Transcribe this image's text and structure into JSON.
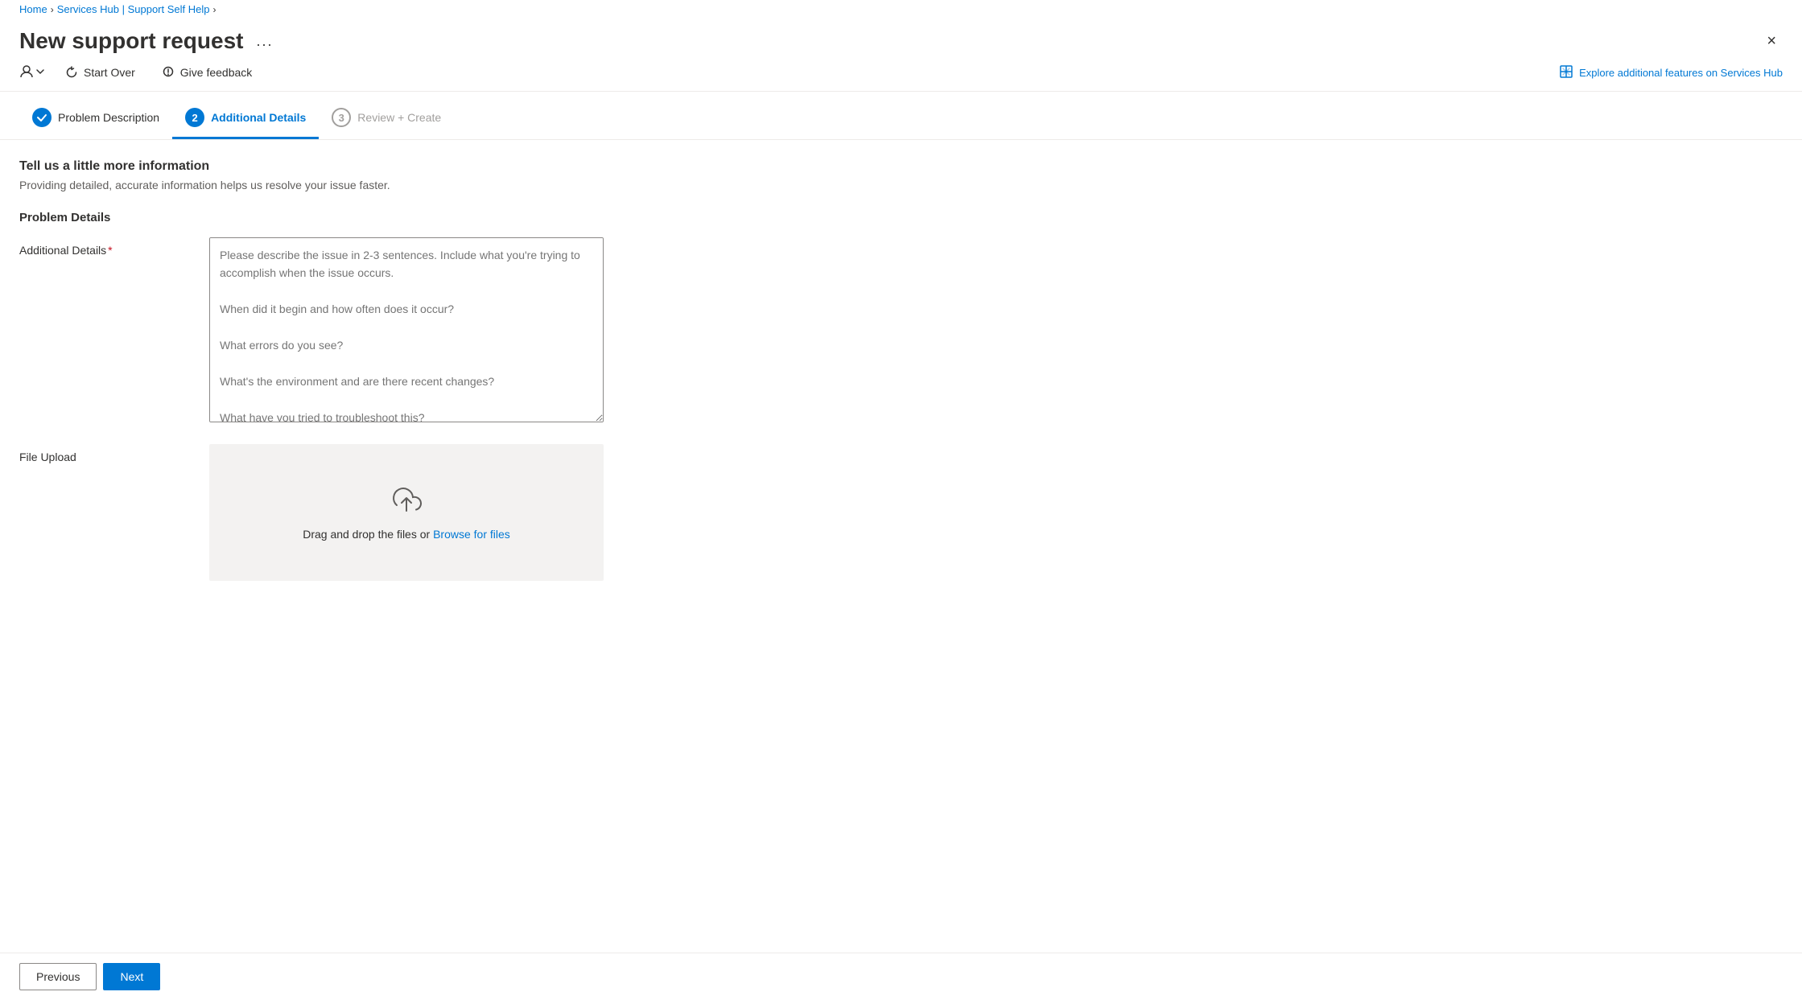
{
  "breadcrumb": {
    "home": "Home",
    "servicesHub": "Services Hub | Support Self Help"
  },
  "header": {
    "title": "New support request",
    "ellipsis": "...",
    "close": "×"
  },
  "toolbar": {
    "startOver": "Start Over",
    "giveFeedback": "Give feedback",
    "exploreFeatures": "Explore additional features on Services Hub"
  },
  "steps": [
    {
      "number": "✓",
      "label": "Problem Description",
      "state": "completed"
    },
    {
      "number": "2",
      "label": "Additional Details",
      "state": "active"
    },
    {
      "number": "3",
      "label": "Review + Create",
      "state": "inactive"
    }
  ],
  "form": {
    "sectionTitle": "Tell us a little more information",
    "sectionSubtitle": "Providing detailed, accurate information helps us resolve your issue faster.",
    "problemDetailsTitle": "Problem Details",
    "additionalDetailsLabel": "Additional Details",
    "additionalDetailsPlaceholder": "Please describe the issue in 2-3 sentences. Include what you're trying to accomplish when the issue occurs.\n\nWhen did it begin and how often does it occur?\n\nWhat errors do you see?\n\nWhat's the environment and are there recent changes?\n\nWhat have you tried to troubleshoot this?",
    "fileUploadLabel": "File Upload",
    "fileUploadText": "Drag and drop the files or",
    "browseFilesLink": "Browse for files"
  },
  "footer": {
    "previous": "Previous",
    "next": "Next"
  }
}
